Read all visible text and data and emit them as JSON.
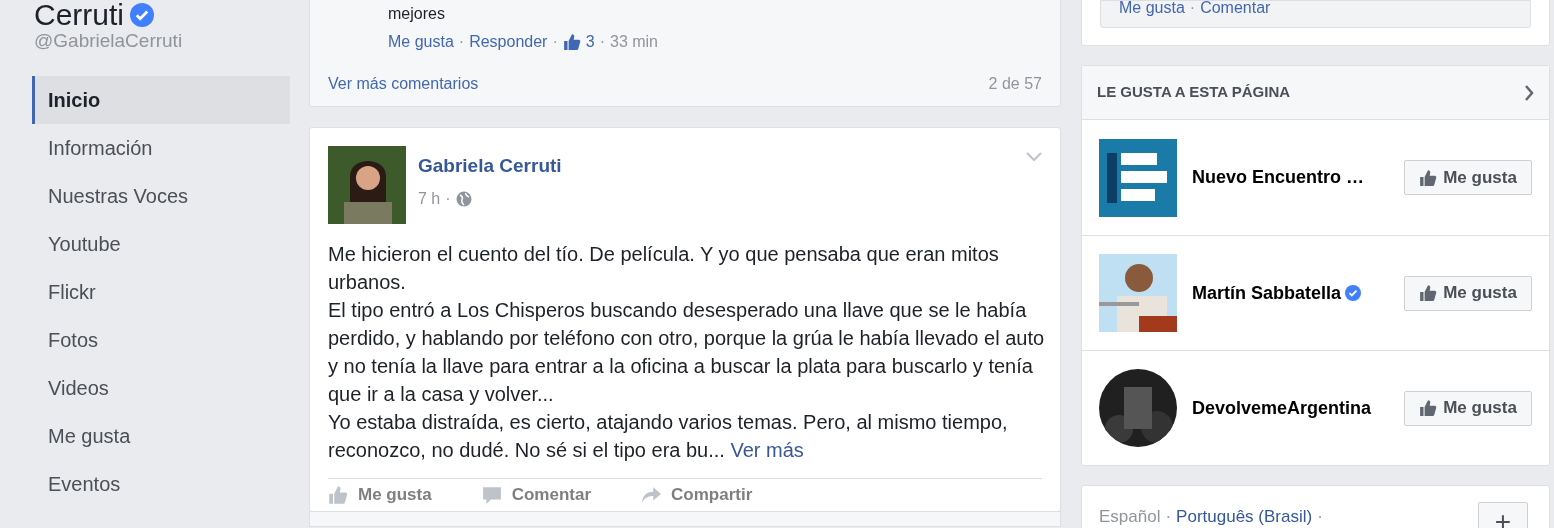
{
  "profile": {
    "name": "Cerruti",
    "verified": true,
    "handle": "@GabrielaCerruti"
  },
  "sidebar": {
    "items": [
      {
        "label": "Inicio",
        "selected": true
      },
      {
        "label": "Información",
        "selected": false
      },
      {
        "label": "Nuestras Voces",
        "selected": false
      },
      {
        "label": "Youtube",
        "selected": false
      },
      {
        "label": "Flickr",
        "selected": false
      },
      {
        "label": "Fotos",
        "selected": false
      },
      {
        "label": "Videos",
        "selected": false
      },
      {
        "label": "Me gusta",
        "selected": false
      },
      {
        "label": "Eventos",
        "selected": false
      }
    ]
  },
  "comments": {
    "separators": [
      "·",
      "·",
      "·"
    ],
    "last_line": "mejores",
    "actions": [
      "Me gusta",
      "Responder"
    ],
    "likes": "3",
    "time": "33 min",
    "more": "Ver más comentarios",
    "count": "2 de 57"
  },
  "post": {
    "author": "Gabriela Cerruti",
    "time": "7 h",
    "separator": "·",
    "paragraphs": [
      "Me hicieron el cuento del tío. De película. Y yo que pensaba que eran mitos urbanos.",
      "El tipo entró a Los Chisperos buscando desesperado una llave que se le había perdido, y hablando por teléfono con otro, porque la grúa le había llevado el auto y no tenía la llave para entrar a la oficina a buscar la plata para buscarlo y tenía que ir a la casa y volver...",
      "Yo estaba distraída, es cierto, atajando varios temas. Pero, al mismo tiempo, reconozco, no dudé. No sé si el tipo era bu..."
    ],
    "see_more": "Ver más",
    "actions": [
      {
        "kind": "like",
        "label": "Me gusta"
      },
      {
        "kind": "comment",
        "label": "Comentar"
      },
      {
        "kind": "share",
        "label": "Compartir"
      }
    ]
  },
  "right": {
    "top_actions": [
      "Me gusta",
      "Comentar"
    ],
    "top_separator": "·",
    "liked_pages": {
      "title": "LE GUSTA A ESTA PÁGINA",
      "pages": [
        {
          "name": "Nuevo Encuentro …",
          "verified": false,
          "kind": "square",
          "button": "Me gusta"
        },
        {
          "name": "Martín Sabbatella",
          "verified": true,
          "kind": "square",
          "button": "Me gusta"
        },
        {
          "name": "DevolvemeArgentina",
          "verified": false,
          "kind": "round",
          "button": "Me gusta"
        }
      ]
    },
    "languages": {
      "separators": [
        "·",
        "·"
      ],
      "current": "Español",
      "other": "Português (Brasil)",
      "add": "+"
    }
  }
}
